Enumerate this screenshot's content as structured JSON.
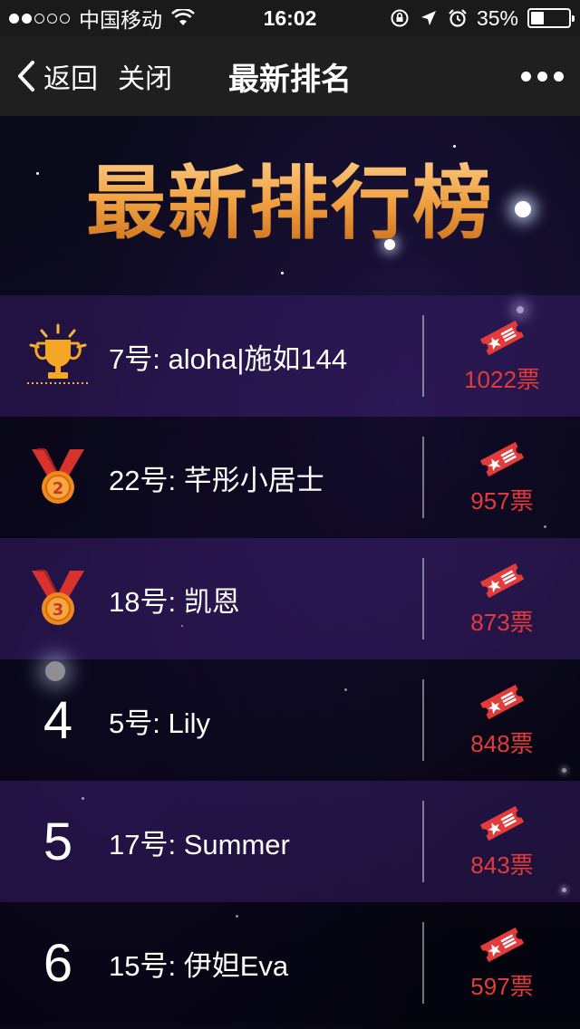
{
  "status_bar": {
    "carrier": "中国移动",
    "time": "16:02",
    "battery": "35%",
    "battery_level": 0.35
  },
  "nav": {
    "back_label": "返回",
    "close_label": "关闭",
    "title": "最新排名"
  },
  "banner": {
    "title": "最新排行榜"
  },
  "rows": [
    {
      "rank": "trophy-icon",
      "name": "7号:  aloha|施如144",
      "votes": "1022票"
    },
    {
      "rank": "silver-medal-icon",
      "name": "22号:  芊彤小居士",
      "votes": "957票"
    },
    {
      "rank": "bronze-medal-icon",
      "name": "18号:  凯恩",
      "votes": "873票"
    },
    {
      "rank": "4",
      "name": "5号:  Lily",
      "votes": "848票"
    },
    {
      "rank": "5",
      "name": "17号:  Summer",
      "votes": "843票"
    },
    {
      "rank": "6",
      "name": "15号:  伊妲Eva",
      "votes": "597票"
    }
  ],
  "colors": {
    "accent": "#e23b3b",
    "banner_gold": "#f0a040",
    "row_purple": "#3c1e6e"
  }
}
